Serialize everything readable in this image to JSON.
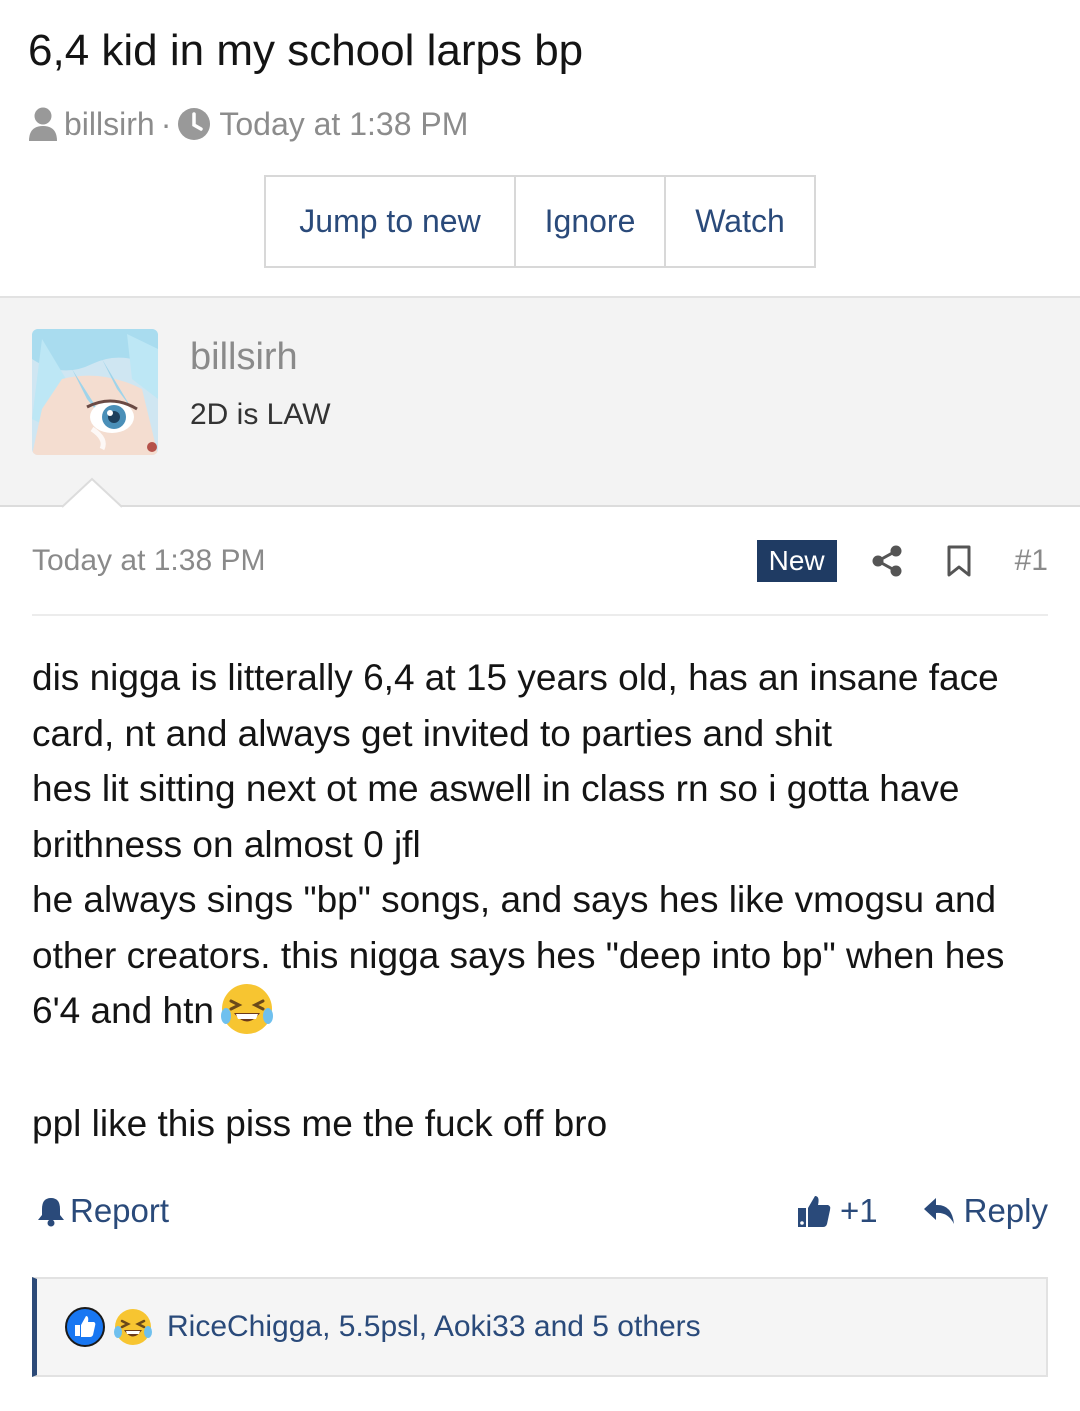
{
  "thread": {
    "title": "6,4 kid in my school larps bp",
    "author": "billsirh",
    "separator": "·",
    "time": "Today at 1:38 PM"
  },
  "actions": {
    "jump_to_new": "Jump to new",
    "ignore": "Ignore",
    "watch": "Watch"
  },
  "user": {
    "name": "billsirh",
    "title": "2D is LAW"
  },
  "post": {
    "date": "Today at 1:38 PM",
    "badge": "New",
    "number": "#1",
    "lines": [
      "dis nigga is litterally 6,4 at 15 years old, has an insane face",
      "card, nt and always get invited to parties and shit",
      "hes lit sitting next ot me aswell in class rn so i gotta have",
      "brithness on almost 0 jfl",
      "he always sings \"bp\" songs, and says hes like vmogsu and",
      "other creators. this nigga says hes \"deep into bp\" when hes",
      "6'4 and htn",
      "ppl like this piss me the fuck off bro"
    ]
  },
  "footer": {
    "report": "Report",
    "like_count": "+1",
    "reply": "Reply"
  },
  "reactions": {
    "text": "RiceChigga, 5.5psl, Aoki33 and 5 others"
  },
  "colors": {
    "link": "#2a4a7a",
    "badge_bg": "#1f3b63",
    "reaction_border": "#2c4a78",
    "muted": "#8a8a8a"
  }
}
